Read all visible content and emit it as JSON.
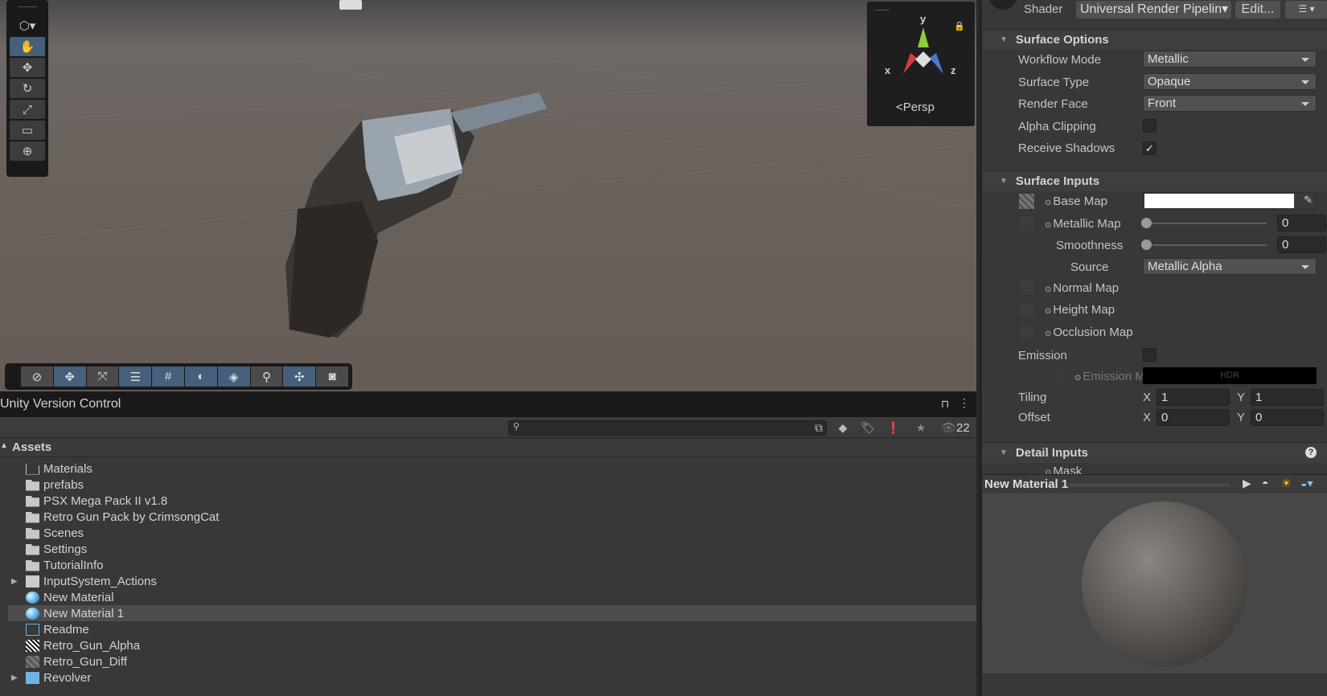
{
  "scene": {
    "view_label": "Persp",
    "axes": {
      "x": "x",
      "y": "y",
      "z": "z"
    },
    "left_tools": [
      "view-tool",
      "move-tool",
      "rotate-tool",
      "scale-tool",
      "rect-tool",
      "transform-tool"
    ],
    "bottom_tools": [
      {
        "icon": "orientation-icon",
        "on": false
      },
      {
        "icon": "move-snap-icon",
        "on": true
      },
      {
        "icon": "increment-snap-icon",
        "on": false
      },
      {
        "icon": "scene-settings-icon",
        "on": true
      },
      {
        "icon": "grid-icon",
        "on": true
      },
      {
        "icon": "lighting-icon",
        "on": true
      },
      {
        "icon": "effects-icon",
        "on": true
      },
      {
        "icon": "zoom-icon",
        "on": false
      },
      {
        "icon": "pivot-icon",
        "on": true
      },
      {
        "icon": "camera-visibility-icon",
        "on": false
      }
    ]
  },
  "project": {
    "title": "Unity Version Control",
    "hidden_count": "22",
    "root": "Assets",
    "items": [
      {
        "name": "Materials",
        "type": "folder-empty"
      },
      {
        "name": "prefabs",
        "type": "folder"
      },
      {
        "name": "PSX Mega Pack II v1.8",
        "type": "folder"
      },
      {
        "name": "Retro Gun Pack by CrimsongCat",
        "type": "folder"
      },
      {
        "name": "Scenes",
        "type": "folder"
      },
      {
        "name": "Settings",
        "type": "folder"
      },
      {
        "name": "TutorialInfo",
        "type": "folder"
      },
      {
        "name": "InputSystem_Actions",
        "type": "input-actions",
        "expandable": true
      },
      {
        "name": "New Material",
        "type": "material"
      },
      {
        "name": "New Material 1",
        "type": "material",
        "selected": true
      },
      {
        "name": "Readme",
        "type": "readme"
      },
      {
        "name": "Retro_Gun_Alpha",
        "type": "texture-alpha"
      },
      {
        "name": "Retro_Gun_Diff",
        "type": "texture"
      },
      {
        "name": "Revolver",
        "type": "prefab",
        "expandable": true
      }
    ]
  },
  "inspector": {
    "shader_label": "Shader",
    "shader_value": "Universal Render Pipelin▾",
    "edit_label": "Edit...",
    "surface_options": {
      "title": "Surface Options",
      "workflow_label": "Workflow Mode",
      "workflow": "Metallic",
      "surface_type_label": "Surface Type",
      "surface_type": "Opaque",
      "render_face_label": "Render Face",
      "render_face": "Front",
      "alpha_clipping_label": "Alpha Clipping",
      "alpha_clipping": false,
      "receive_shadows_label": "Receive Shadows",
      "receive_shadows": true,
      "check": "✓"
    },
    "surface_inputs": {
      "title": "Surface Inputs",
      "base_map": "Base Map",
      "base_color": "#ffffff",
      "metallic_map": "Metallic Map",
      "metallic": "0",
      "smoothness_label": "Smoothness",
      "smoothness": "0",
      "source_label": "Source",
      "source": "Metallic Alpha",
      "normal_map": "Normal Map",
      "height_map": "Height Map",
      "occlusion_map": "Occlusion Map",
      "emission_label": "Emission",
      "emission_map": "Emission M",
      "hdr": "HDR",
      "tiling_label": "Tiling",
      "offset_label": "Offset",
      "x": "X",
      "y": "Y",
      "tiling_x": "1",
      "tiling_y": "1",
      "offset_x": "0",
      "offset_y": "0"
    },
    "detail_inputs": {
      "title": "Detail Inputs",
      "mask": "Mask"
    },
    "preview_title": "New Material 1"
  }
}
